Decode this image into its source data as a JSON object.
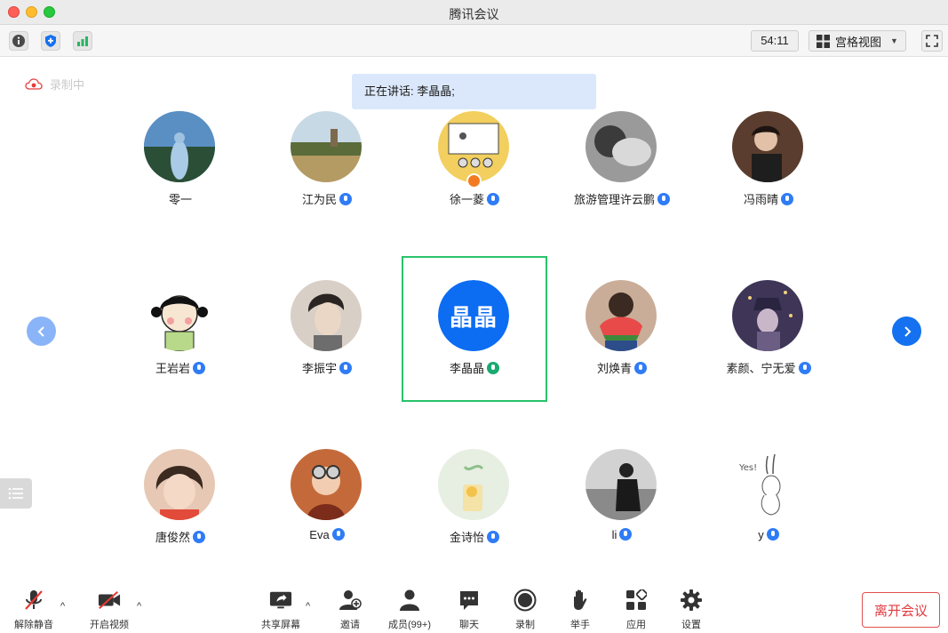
{
  "window": {
    "title": "腾讯会议"
  },
  "toolbar": {
    "timer": "54:11",
    "view_mode": "宫格视图"
  },
  "recording": {
    "label": "录制中"
  },
  "speaking": {
    "text": "正在讲话: 李晶晶;"
  },
  "participants": [
    {
      "name": "零一",
      "mic": "none",
      "avatar_color": "#3a6ea5"
    },
    {
      "name": "江为民",
      "mic": "blue",
      "avatar_color": "#8a7f55"
    },
    {
      "name": "徐一菱",
      "mic": "blue",
      "avatar_color": "#f2d27a"
    },
    {
      "name": "旅游管理许云鹏",
      "mic": "blue",
      "avatar_color": "#8d8d8d"
    },
    {
      "name": "冯雨晴",
      "mic": "blue",
      "avatar_color": "#4a3328"
    },
    {
      "name": "王岩岩",
      "mic": "blue",
      "avatar_color": "#f4eddc"
    },
    {
      "name": "李振宇",
      "mic": "blue",
      "avatar_color": "#b8ada3"
    },
    {
      "name": "李晶晶",
      "mic": "green",
      "initials": "晶晶",
      "avatar_color": "#0c6cf2"
    },
    {
      "name": "刘焕青",
      "mic": "blue",
      "avatar_color": "#c7a894"
    },
    {
      "name": "素颜、宁无爱",
      "mic": "blue",
      "avatar_color": "#5a4c6e"
    },
    {
      "name": "唐俊然",
      "mic": "blue",
      "avatar_color": "#d9b09a"
    },
    {
      "name": "Eva",
      "mic": "blue",
      "avatar_color": "#b5562c"
    },
    {
      "name": "金诗怡",
      "mic": "blue",
      "avatar_color": "#dfeadc"
    },
    {
      "name": "li",
      "mic": "blue",
      "avatar_color": "#6c6c6c"
    },
    {
      "name": "y",
      "mic": "blue",
      "avatar_color": "#f6f6f6"
    }
  ],
  "bottom": {
    "unmute": "解除静音",
    "start_video": "开启视频",
    "share_screen": "共享屏幕",
    "invite": "邀请",
    "members": "成员(99+)",
    "chat": "聊天",
    "record": "录制",
    "raise_hand": "举手",
    "apps": "应用",
    "settings": "设置",
    "leave": "离开会议"
  },
  "colors": {
    "accent": "#1571f0",
    "active_border": "#28c36a",
    "leave": "#e0393e"
  }
}
